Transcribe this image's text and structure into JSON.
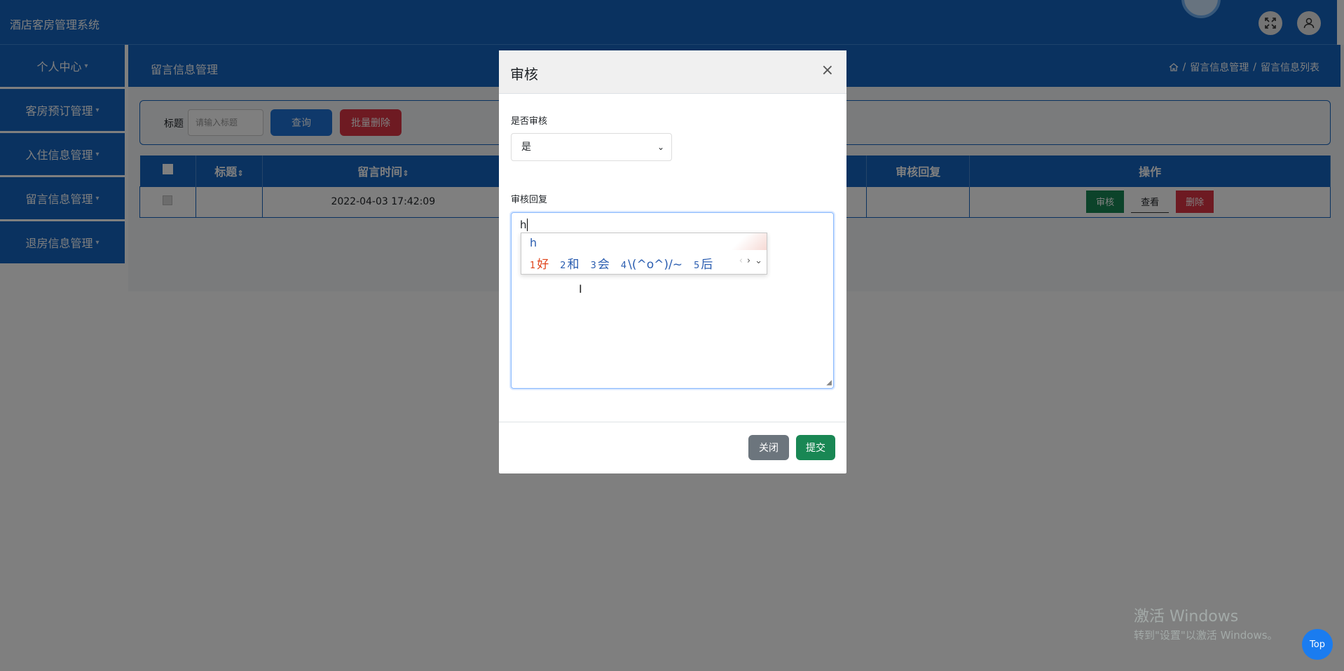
{
  "app": {
    "title": "酒店客房管理系统"
  },
  "sidebar": {
    "items": [
      {
        "label": "个人中心"
      },
      {
        "label": "客房预订管理"
      },
      {
        "label": "入住信息管理"
      },
      {
        "label": "留言信息管理"
      },
      {
        "label": "退房信息管理"
      }
    ]
  },
  "page": {
    "title": "留言信息管理",
    "breadcrumb": [
      "留言信息管理",
      "留言信息列表"
    ]
  },
  "search": {
    "label": "标题",
    "placeholder": "请输入标题",
    "query_label": "查询",
    "batch_delete_label": "批量删除"
  },
  "table": {
    "headers": {
      "title": "标题",
      "time": "留言时间",
      "reply": "审核回复",
      "actions": "操作"
    },
    "rows": [
      {
        "title": "",
        "time": "2022-04-03 17:42:09",
        "reply": ""
      }
    ],
    "actions": {
      "review": "审核",
      "view": "查看",
      "delete": "删除"
    }
  },
  "modal": {
    "title": "审核",
    "close_glyph": "×",
    "field_review_label": "是否审核",
    "field_review_value": "是",
    "field_reply_label": "审核回复",
    "field_reply_value": "h",
    "close_button": "关闭",
    "submit_button": "提交"
  },
  "ime": {
    "composition": "h",
    "candidates": [
      {
        "n": "1",
        "text": "好"
      },
      {
        "n": "2",
        "text": "和"
      },
      {
        "n": "3",
        "text": "会"
      },
      {
        "n": "4",
        "text": "\\(^o^)/~"
      },
      {
        "n": "5",
        "text": "后"
      }
    ]
  },
  "watermark": {
    "line1": "激活 Windows",
    "line2": "转到\"设置\"以激活 Windows。"
  },
  "top_button": "Top",
  "colors": {
    "primary": "#1565c0",
    "danger": "#dc3545",
    "success": "#198754",
    "secondary": "#6c757d"
  }
}
